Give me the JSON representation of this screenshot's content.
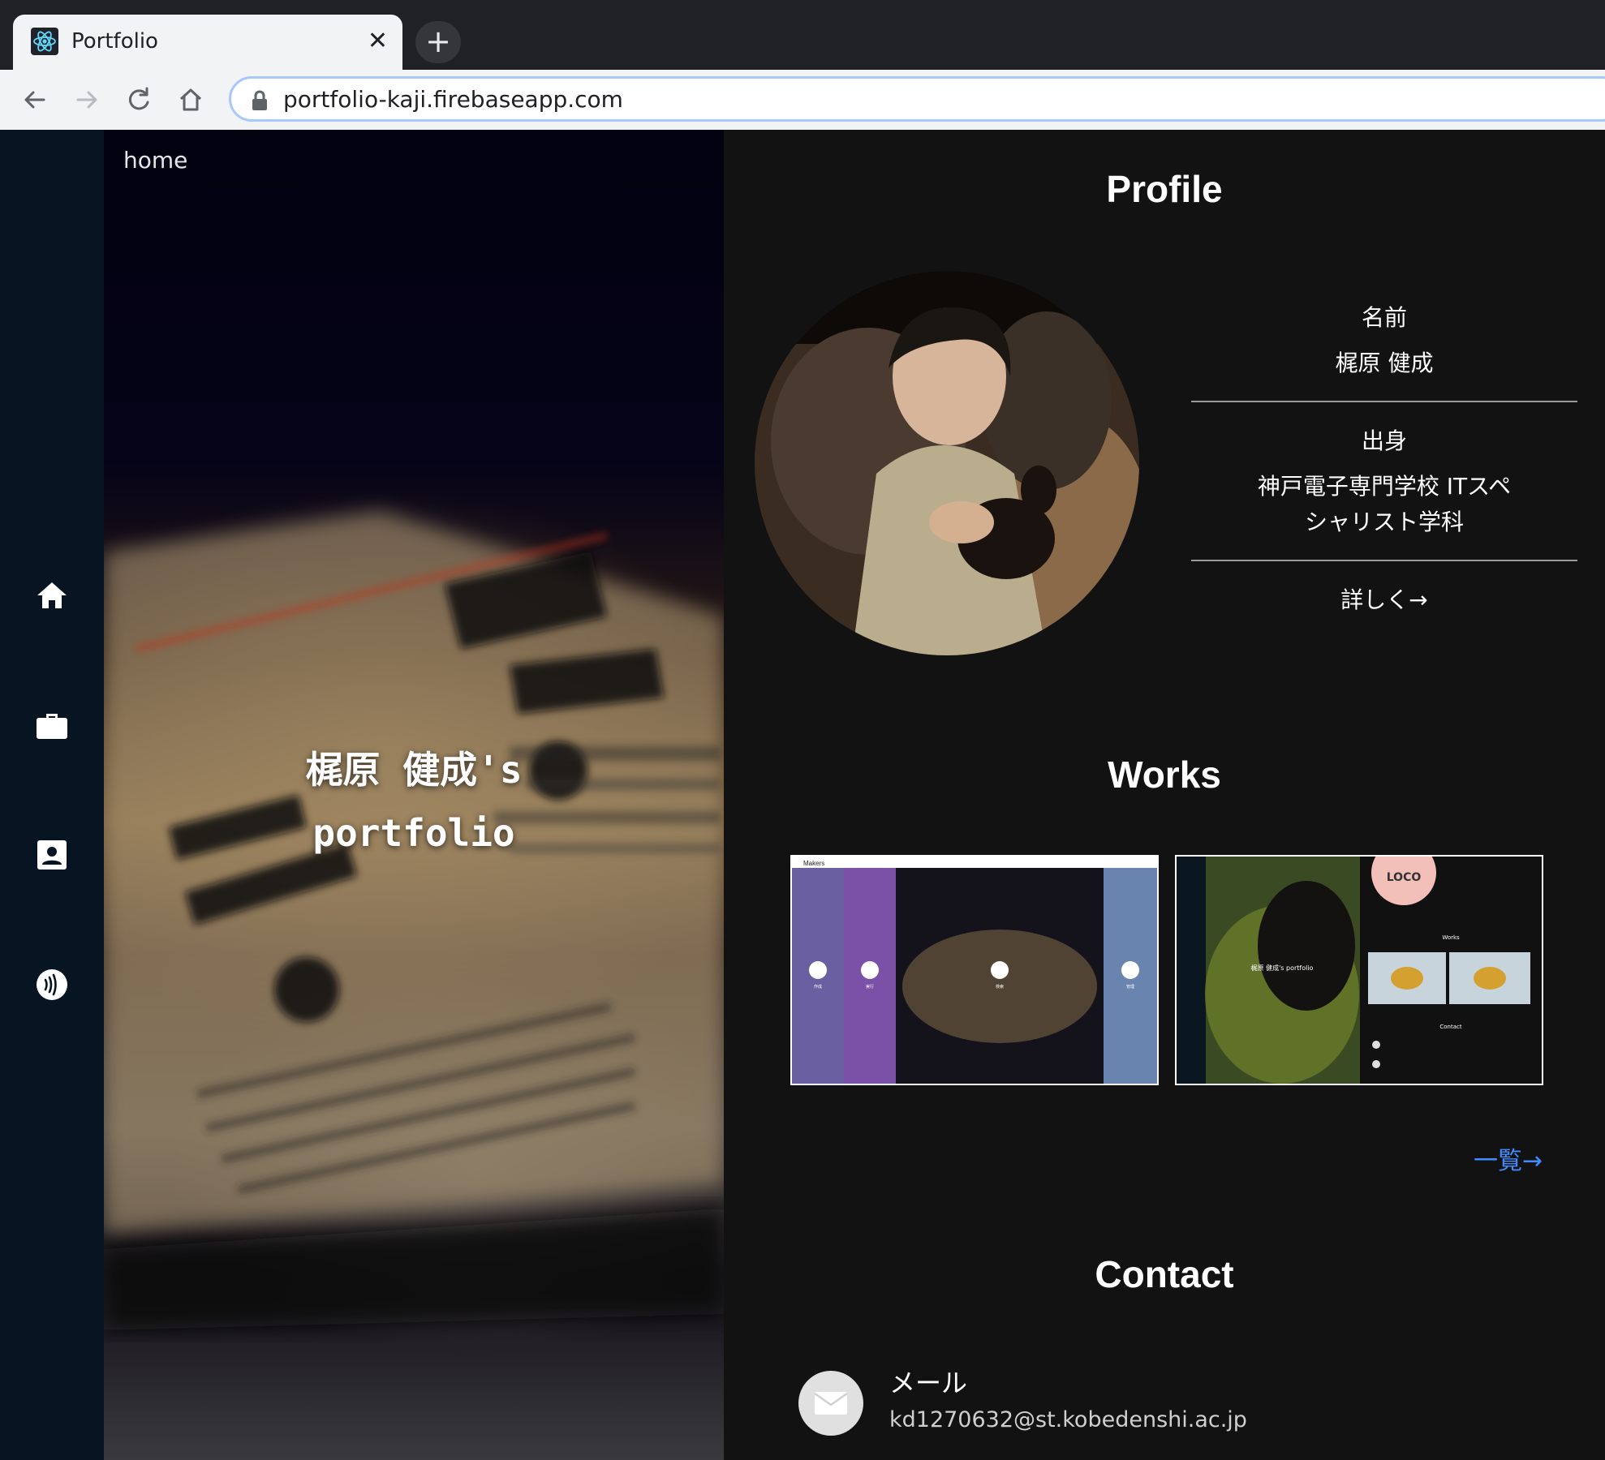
{
  "browser": {
    "tab_title": "Portfolio",
    "tab_close": "✕",
    "new_tab": "+",
    "url": "portfolio-kaji.firebaseapp.com"
  },
  "nav": {
    "items": [
      {
        "icon": "home-icon"
      },
      {
        "icon": "briefcase-icon"
      },
      {
        "icon": "contact-card-icon"
      },
      {
        "icon": "contactless-icon"
      }
    ]
  },
  "hero": {
    "breadcrumb": "home",
    "title_line1": "梶原 健成's",
    "title_line2": "portfolio"
  },
  "profile": {
    "heading": "Profile",
    "name_label": "名前",
    "name_value": "梶原 健成",
    "origin_label": "出身",
    "origin_value_line1": "神戸電子専門学校 ITスペ",
    "origin_value_line2": "シャリスト学科",
    "more_link": "詳しく→"
  },
  "works": {
    "heading": "Works",
    "list_link": "一覧→",
    "thumbs": [
      {
        "header": "Makers",
        "labels": [
          "作成",
          "実行",
          "検索",
          "管理"
        ]
      },
      {
        "logo": "LOCO",
        "title": "梶原 健成's portfolio",
        "works_label": "Works",
        "contact_label": "Contact"
      }
    ]
  },
  "contact": {
    "heading": "Contact",
    "mail_label": "メール",
    "mail_value": "kd1270632@st.kobedenshi.ac.jp"
  },
  "colors": {
    "rail_bg": "#061521",
    "main_bg": "#121212",
    "link_blue": "#3f8cff"
  }
}
